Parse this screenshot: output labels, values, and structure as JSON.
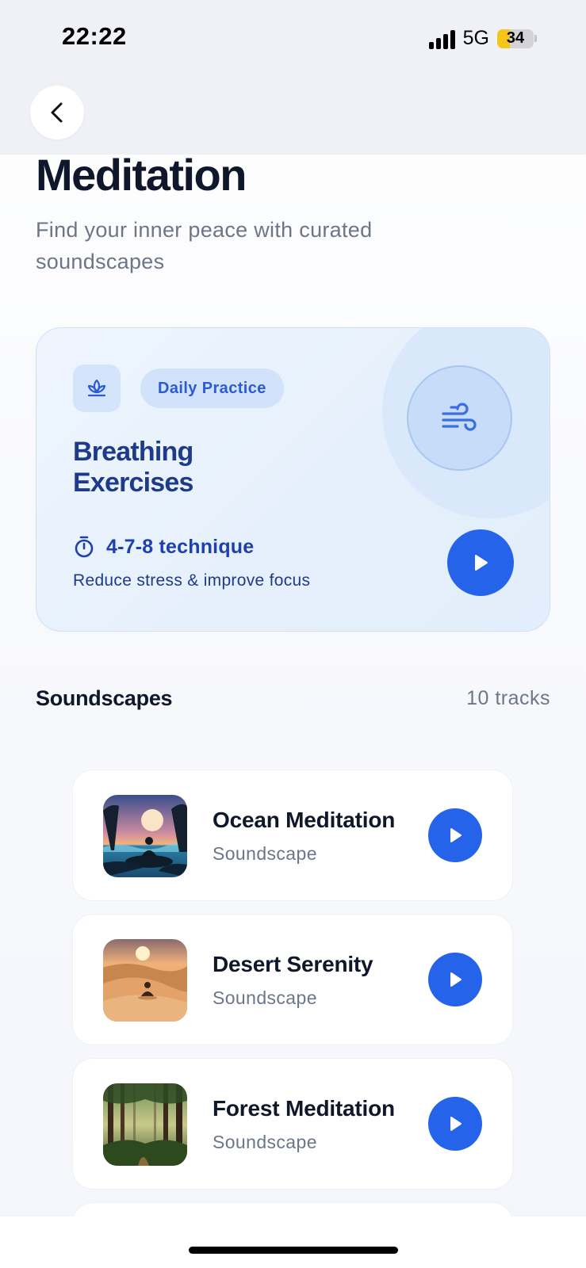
{
  "status_bar": {
    "time": "22:22",
    "network": "5G",
    "battery_level": "34",
    "battery_fraction": 0.34,
    "battery_color": "#f5c518"
  },
  "nav": {
    "back_icon": "chevron-left-icon"
  },
  "header": {
    "title": "Meditation",
    "subtitle": "Find your inner peace with curated soundscapes"
  },
  "featured": {
    "icon": "lotus-icon",
    "badge": "Daily Practice",
    "title_line1": "Breathing",
    "title_line2": "Exercises",
    "timer_icon": "stopwatch-icon",
    "technique": "4-7-8 technique",
    "description": "Reduce stress & improve focus",
    "wind_icon": "wind-icon",
    "play_icon": "play-icon",
    "accent_color": "#2563eb"
  },
  "soundscapes": {
    "title": "Soundscapes",
    "count": "10 tracks",
    "tracks": [
      {
        "name": "Ocean Meditation",
        "type": "Soundscape",
        "thumb": "ocean-meditation-artwork"
      },
      {
        "name": "Desert Serenity",
        "type": "Soundscape",
        "thumb": "desert-serenity-artwork"
      },
      {
        "name": "Forest Meditation",
        "type": "Soundscape",
        "thumb": "forest-meditation-artwork"
      }
    ]
  }
}
